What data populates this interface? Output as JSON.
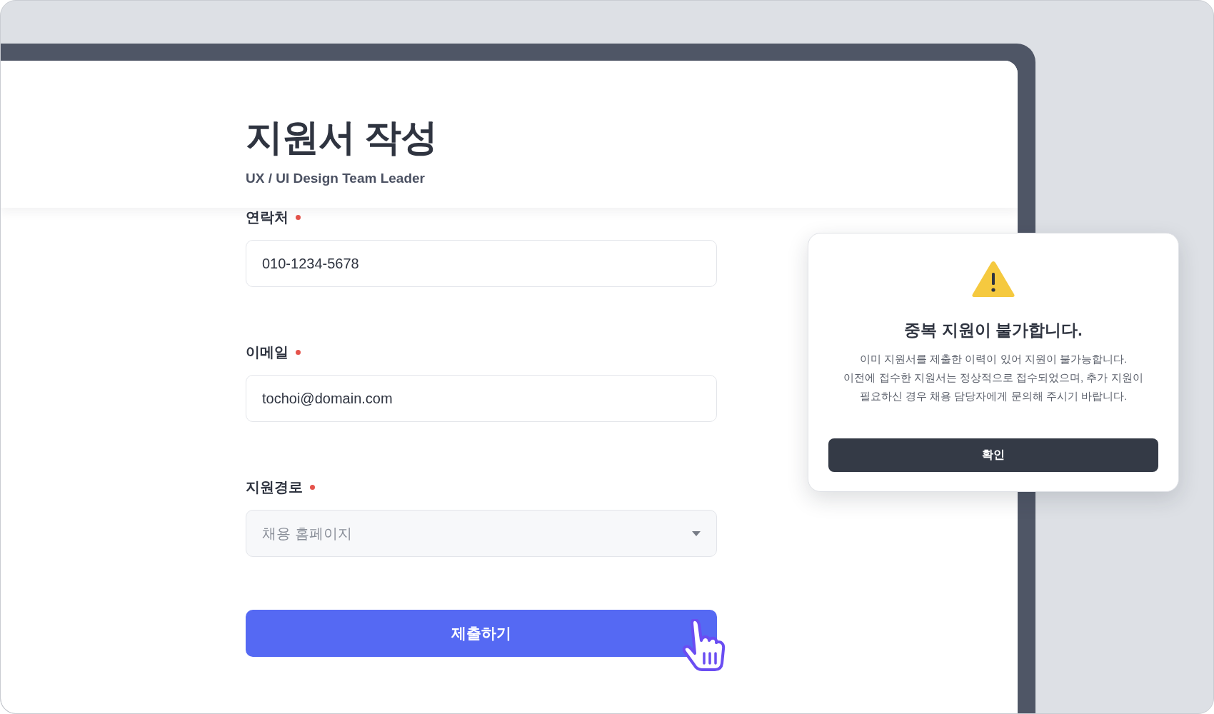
{
  "header": {
    "title": "지원서 작성",
    "subtitle": "UX / UI Design Team Leader"
  },
  "fields": [
    {
      "kind": "text",
      "label": "연락처",
      "required": true,
      "value": "010-1234-5678"
    },
    {
      "kind": "text",
      "label": "이메일",
      "required": true,
      "value": "tochoi@domain.com"
    },
    {
      "kind": "select",
      "label": "지원경로",
      "required": true,
      "placeholder": "채용 홈페이지"
    }
  ],
  "submit_button": "제출하기",
  "dialog": {
    "title": "중복 지원이 불가합니다.",
    "message_lines": [
      "이미 지원서를 제출한 이력이 있어 지원이 불가능합니다.",
      "이전에 접수한 지원서는 정상적으로 접수되었으며, 추가 지원이",
      "필요하신 경우 채용 담당자에게 문의해 주시기 바랍니다."
    ],
    "confirm_button": "확인"
  }
}
